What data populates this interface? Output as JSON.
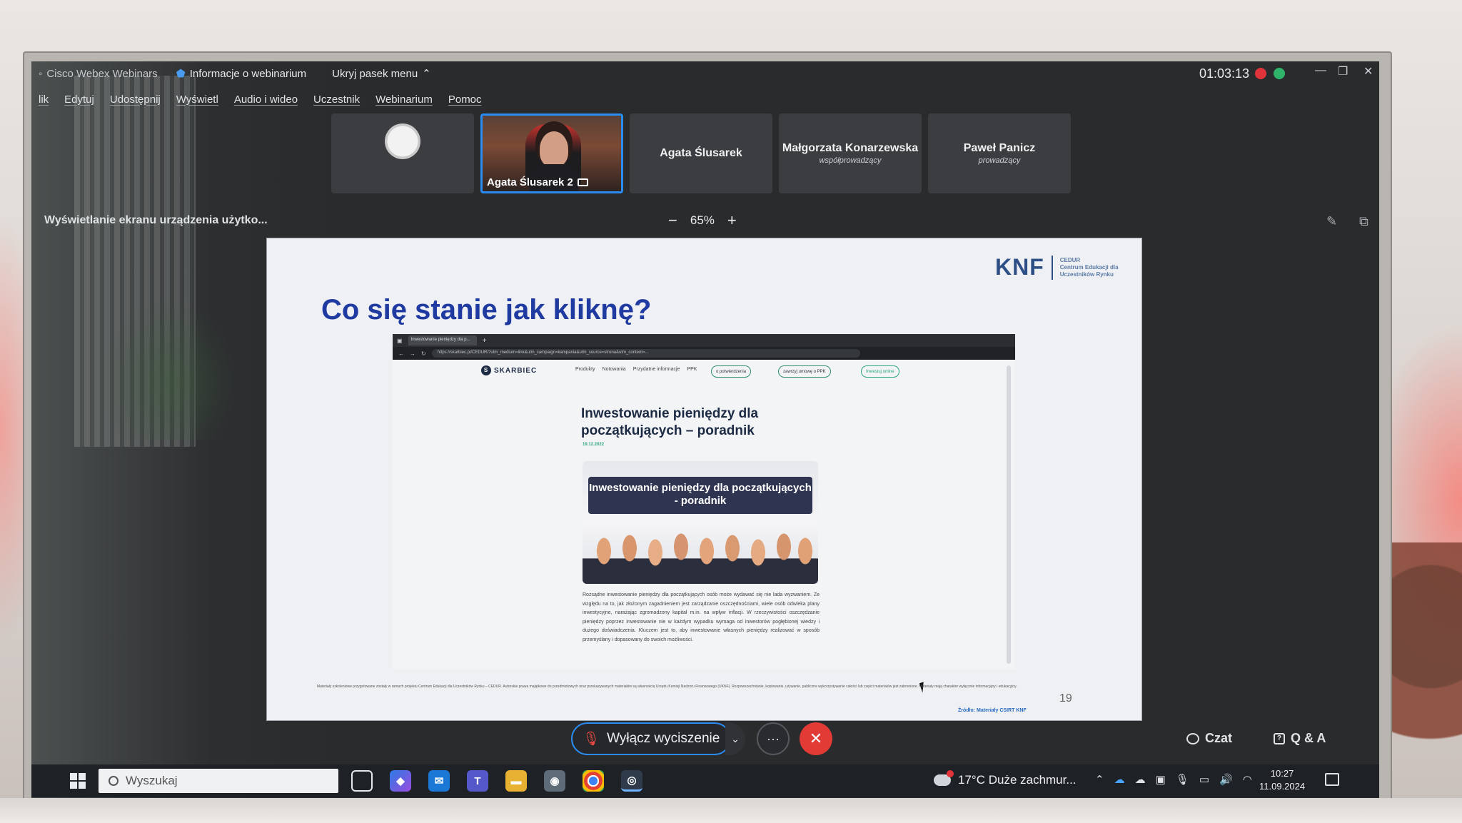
{
  "webex": {
    "app_title": "Cisco Webex Webinars",
    "info_label": "Informacje o webinarium",
    "hide_bar_label": "Ukryj pasek menu",
    "timer": "01:03:13",
    "menu": [
      "lik",
      "Edytuj",
      "Udostępnij",
      "Wyświetl",
      "Audio i wideo",
      "Uczestnik",
      "Webinarium",
      "Pomoc"
    ],
    "participants": [
      {
        "name": "",
        "role": ""
      },
      {
        "name": "Agata Ślusarek 2",
        "role": ""
      },
      {
        "name": "Agata Ślusarek",
        "role": ""
      },
      {
        "name": "Małgorzata Konarzewska",
        "role": "współprowadzący"
      },
      {
        "name": "Paweł Panicz",
        "role": "prowadzący"
      }
    ],
    "share_info": "Wyświetlanie ekranu urządzenia użytko...",
    "zoom_minus": "−",
    "zoom_level": "65%",
    "zoom_plus": "+",
    "unmute_label": "Wyłącz wyciszenie",
    "more_label": "···",
    "leave_label": "✕",
    "chat_label": "Czat",
    "qa_label": "Q & A"
  },
  "slide": {
    "org_logo": "KNF",
    "org_text_1": "CEDUR",
    "org_text_2": "Centrum Edukacji dla",
    "org_text_3": "Uczestników Rynku",
    "title": "Co się stanie jak kliknę?",
    "browser": {
      "tab_title": "Inwestowanie pieniędzy dla p...",
      "address": "https://skarbiec.pl/CEDUR/?utm_medium=link&utm_campaign=kampania&utm_source=strona&utm_content=...",
      "site_logo": "SKARBIEC",
      "nav_links": [
        "Produkty",
        "Notowania",
        "Przydatne informacje",
        "PPK"
      ],
      "pill_1": "o potwierdzenia",
      "pill_2": "zawrzyj umowę o PPK",
      "pill_3": "Inwestuj online",
      "article_title": "Inwestowanie pieniędzy dla początkujących – poradnik",
      "article_date": "19.12.2022",
      "hero_text": "Inwestowanie pieniędzy dla początkujących - poradnik",
      "article_body": "Rozsądne inwestowanie pieniędzy dla początkujących osób może wydawać się nie lada wyzwaniem. Ze względu na to, jak złożonym zagadnieniem jest zarządzanie oszczędnościami, wiele osób odwleka plany inwestycyjne, narażając zgromadzony kapitał m.in. na wpływ inflacji. W rzeczywistości oszczędzanie pieniędzy poprzez inwestowanie nie w każdym wypadku wymaga od inwestorów pogłębionej wiedzy i dużego doświadczenia. Kluczem jest to, aby inwestowanie własnych pieniędzy realizować w sposób przemyślany i dopasowany do swoich możliwości."
    },
    "footer_text": "Materiały szkoleniowe przygotowane zostały w ramach projektu Centrum Edukacji dla Uczestników Rynku – CEDUR. Autorskie prawa majątkowe do przedmiotowych oraz przekazywanych materiałów są własnością Urzędu Komisji Nadzoru Finansowego (UKNF). Rozpowszechnianie, kopiowanie, używanie, publiczne wykorzystywanie całości lub części materiałów jest zabronione. Materiały mają charakter wyłącznie informacyjny i edukacyjny.",
    "page_number": "19",
    "source": "Źródło: Materiały CSIRT KNF"
  },
  "taskbar": {
    "search_placeholder": "Wyszukaj",
    "weather": "17°C  Duże zachmur...",
    "time": "10:27",
    "date": "11.09.2024"
  },
  "colors": {
    "accent_blue": "#2a8cf0",
    "leave_red": "#e23a35",
    "slide_title": "#1f3aa0",
    "skarbiec_green": "#2aa57f"
  }
}
